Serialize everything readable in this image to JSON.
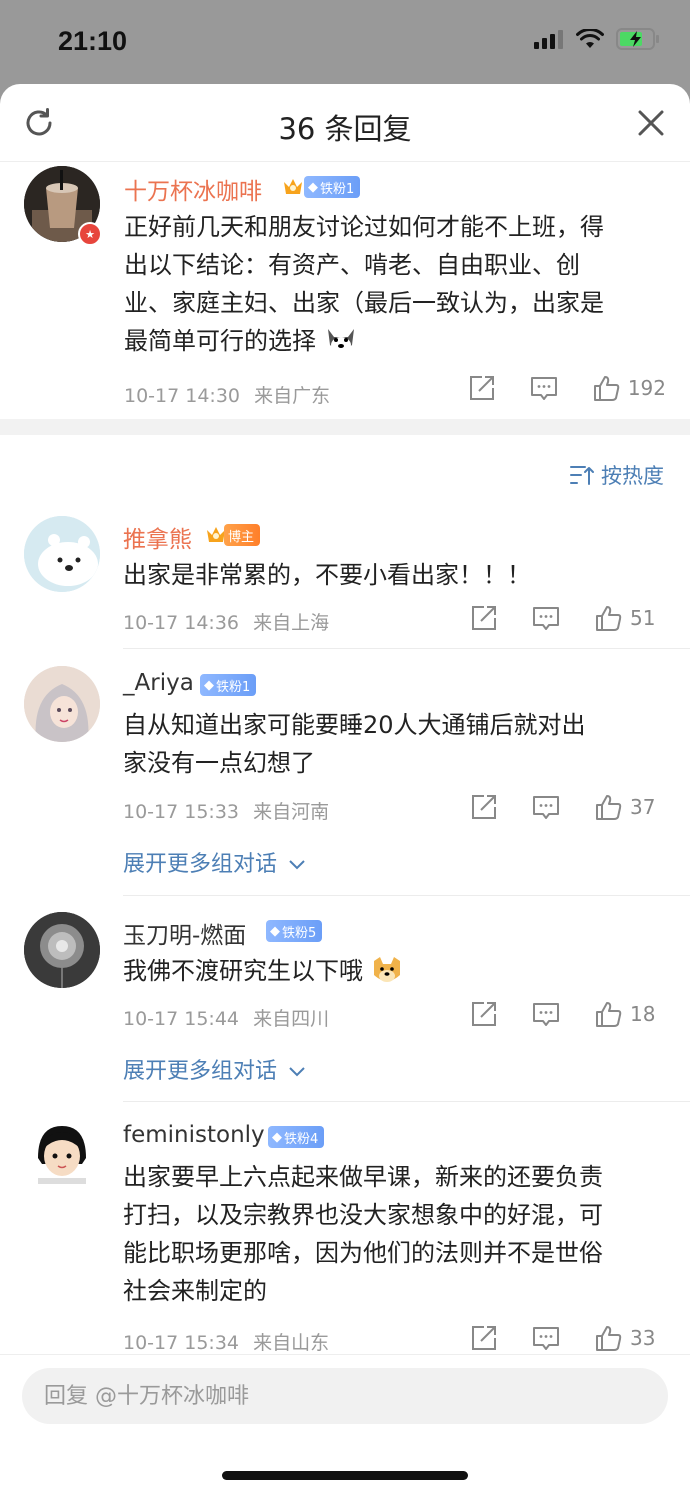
{
  "status_bar": {
    "time": "21:10"
  },
  "header": {
    "title": "36 条回复",
    "refresh_icon": "refresh-icon",
    "close_icon": "close-icon"
  },
  "main_comment": {
    "username": "十万杯冰咖啡",
    "badge": "铁粉1",
    "lines": [
      "正好前几天和朋友讨论过如何才能不上班，得",
      "出以下结论：有资产、啃老、自由职业、创",
      "业、家庭主妇、出家（最后一致认为，出家是",
      "最简单可行的选择"
    ],
    "time": "10-17 14:30",
    "location": "来自广东",
    "likes": "192"
  },
  "sort": {
    "label": "按热度"
  },
  "replies": [
    {
      "username": "推拿熊",
      "badge": "博主",
      "lines": [
        "出家是非常累的，不要小看出家！！！"
      ],
      "time": "10-17 14:36",
      "location": "来自上海",
      "likes": "51"
    },
    {
      "username": "_Ariya",
      "badge": "铁粉1",
      "lines": [
        "自从知道出家可能要睡20人大通铺后就对出",
        "家没有一点幻想了"
      ],
      "time": "10-17 15:33",
      "location": "来自河南",
      "likes": "37",
      "expand": "展开更多组对话"
    },
    {
      "username": "玉刀明-燃面",
      "badge": "铁粉5",
      "lines": [
        "我佛不渡研究生以下哦"
      ],
      "time": "10-17 15:44",
      "location": "来自四川",
      "likes": "18",
      "expand": "展开更多组对话"
    },
    {
      "username": "feministonly",
      "badge": "铁粉4",
      "lines": [
        "出家要早上六点起来做早课，新来的还要负责",
        "打扫，以及宗教界也没大家想象中的好混，可",
        "能比职场更那啥，因为他们的法则并不是世俗",
        "社会来制定的"
      ],
      "time": "10-17 15:34",
      "location": "来自山东",
      "likes": "33"
    }
  ],
  "footer": {
    "reply_placeholder": "回复 @十万杯冰咖啡"
  },
  "colors": {
    "username_highlight": "#eb7350",
    "link_blue": "#4d7fb5",
    "meta_gray": "#9a9a9a"
  }
}
